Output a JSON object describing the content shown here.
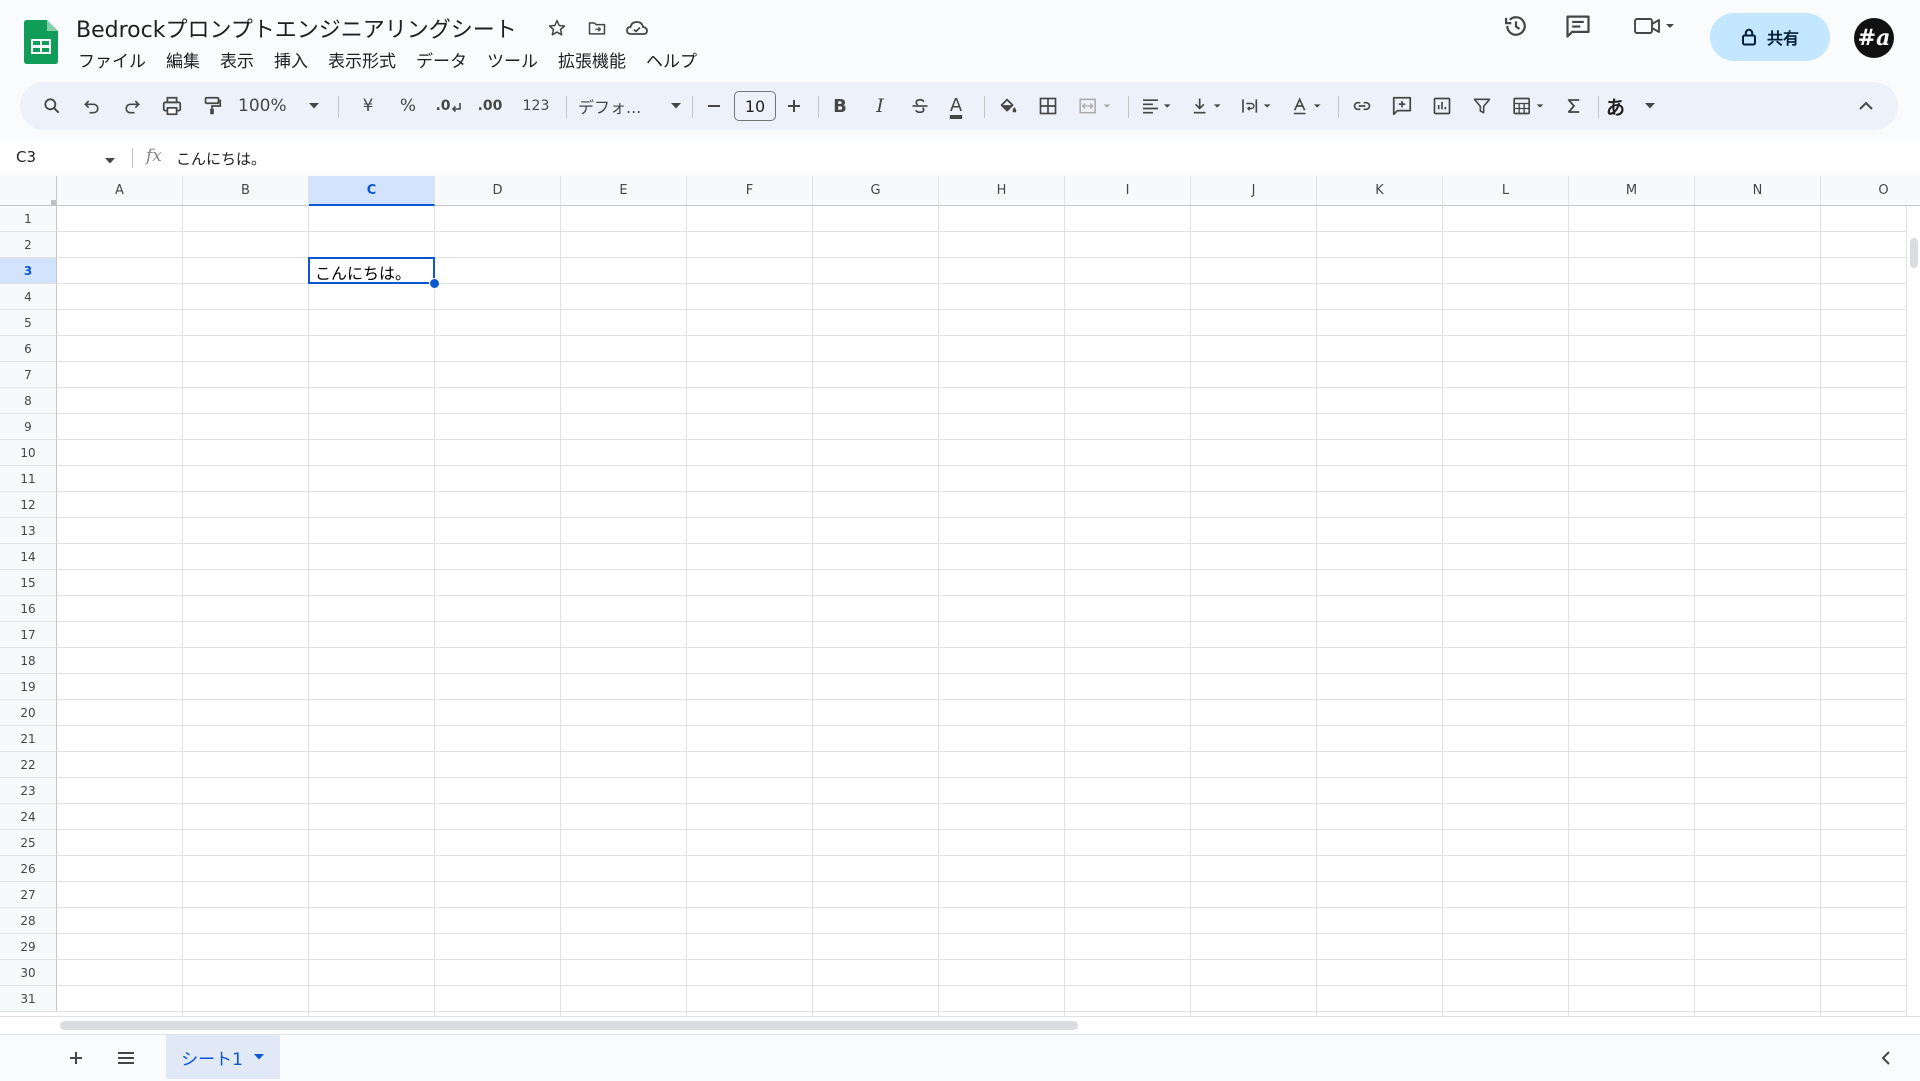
{
  "header": {
    "title": "Bedrockプロンプトエンジニアリングシート",
    "menus": [
      "ファイル",
      "編集",
      "表示",
      "挿入",
      "表示形式",
      "データ",
      "ツール",
      "拡張機能",
      "ヘルプ"
    ],
    "share_label": "共有",
    "avatar_text": "#a"
  },
  "toolbar": {
    "zoom": "100%",
    "currency": "¥",
    "percent": "%",
    "decrease_decimal": ".0",
    "increase_decimal": ".00",
    "number_format": "123",
    "font": "デフォ...",
    "font_size": "10",
    "bold": "B",
    "italic": "I",
    "text_color_glyph": "A",
    "input_tools": "あ"
  },
  "formula_bar": {
    "name_box": "C3",
    "fx": "fx",
    "content": "こんにちは。"
  },
  "grid": {
    "columns": [
      "A",
      "B",
      "C",
      "D",
      "E",
      "F",
      "G",
      "H",
      "I",
      "J",
      "K",
      "L",
      "M",
      "N",
      "O"
    ],
    "rows": [
      "1",
      "2",
      "3",
      "4",
      "5",
      "6",
      "7",
      "8",
      "9",
      "10",
      "11",
      "12",
      "13",
      "14",
      "15",
      "16",
      "17",
      "18",
      "19",
      "20",
      "21",
      "22",
      "23",
      "24",
      "25",
      "26",
      "27",
      "28",
      "29",
      "30",
      "31"
    ],
    "selected_cell": "C3",
    "cells": {
      "C3": "こんにちは。"
    }
  },
  "sheets": {
    "tabs": [
      "シート1"
    ]
  },
  "colors": {
    "accent": "#0b57d0",
    "share_bg": "#c2e7ff",
    "toolbar_bg": "#edf2fa",
    "sheets_green": "#0f9d58"
  }
}
